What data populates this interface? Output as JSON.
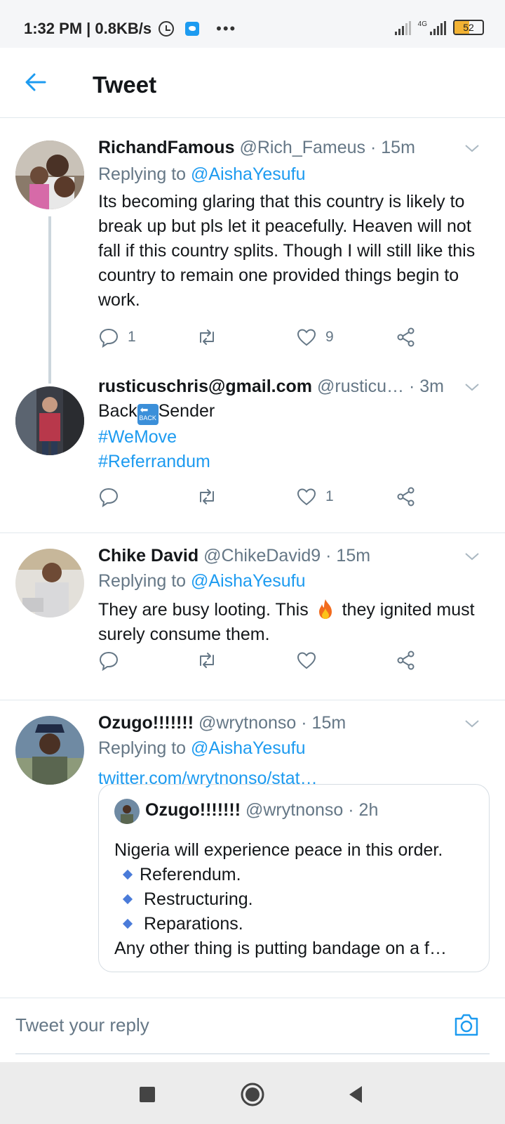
{
  "status_bar": {
    "time": "1:32 PM",
    "speed": "| 0.8KB/s",
    "network_label": "4G",
    "battery": "52",
    "battery_level": 0.52,
    "icons": [
      "alarm-icon",
      "twitter-notif-icon",
      "more-dots-icon",
      "signal-icon",
      "battery-icon"
    ]
  },
  "header": {
    "title": "Tweet"
  },
  "tweets": [
    {
      "name": "RichandFamous",
      "handle": "@Rich_Fameus",
      "time": "· 15m",
      "replying_prefix": "Replying to ",
      "replying_to": "@AishaYesufu",
      "body": "Its becoming glaring that this country is likely to break up but pls let it peacefully. Heaven will not fall if this country splits. Though I will still like this country to remain one provided things begin to work.",
      "replies": "1",
      "retweets": "",
      "likes": "9"
    },
    {
      "name": "rusticuschris@gmail.com",
      "handle": "@rusticu…",
      "time": "· 3m",
      "body_start": "Back",
      "back_emoji": "BACK",
      "body_end": "Sender",
      "hashtags": [
        "#WeMove",
        "#Referrandum"
      ],
      "replies": "",
      "retweets": "",
      "likes": "1"
    },
    {
      "name": "Chike David",
      "handle": "@ChikeDavid9",
      "time": "· 15m",
      "replying_prefix": "Replying to ",
      "replying_to": "@AishaYesufu",
      "body_start": "They are busy looting. This",
      "body_end": "they ignited must surely consume them.",
      "replies": "",
      "retweets": "",
      "likes": ""
    },
    {
      "name": "Ozugo!!!!!!!",
      "handle": "@wrytnonso",
      "time": "· 15m",
      "replying_prefix": "Replying to ",
      "replying_to": "@AishaYesufu",
      "link": "twitter.com/wrytnonso/stat…",
      "quote": {
        "name": "Ozugo!!!!!!!",
        "handle": "@wrytnonso",
        "time": "· 2h",
        "line1": "Nigeria will experience peace in this order.",
        "items": [
          "Referendum.",
          "Restructuring.",
          "Reparations."
        ],
        "line_last": "Any other thing is putting bandage on a f…"
      }
    }
  ],
  "reply_bar": {
    "placeholder": "Tweet your reply"
  },
  "colors": {
    "accent": "#1d9bf0",
    "secondary_text": "#657786",
    "divider": "#e1e8ed"
  }
}
